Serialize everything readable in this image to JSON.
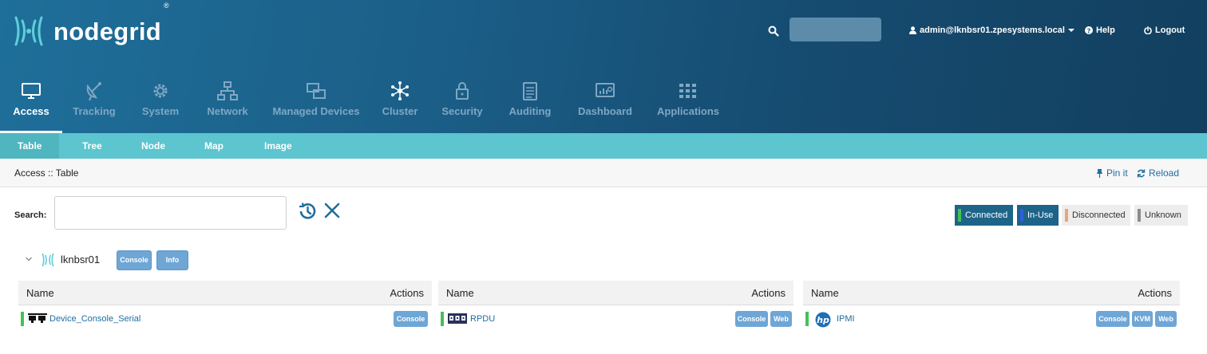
{
  "header": {
    "brand": "nodegrid",
    "brand_reg": "®",
    "search_placeholder": "",
    "user": "admin@lknbsr01.zpesystems.local",
    "help": "Help",
    "logout": "Logout"
  },
  "nav": [
    {
      "label": "Access",
      "icon": "monitor-icon"
    },
    {
      "label": "Tracking",
      "icon": "satellite-dish-icon"
    },
    {
      "label": "System",
      "icon": "gear-icon"
    },
    {
      "label": "Network",
      "icon": "network-icon"
    },
    {
      "label": "Managed Devices",
      "icon": "devices-icon"
    },
    {
      "label": "Cluster",
      "icon": "cluster-icon"
    },
    {
      "label": "Security",
      "icon": "lock-icon"
    },
    {
      "label": "Auditing",
      "icon": "notepad-icon"
    },
    {
      "label": "Dashboard",
      "icon": "dashboard-icon"
    },
    {
      "label": "Applications",
      "icon": "grid-icon"
    }
  ],
  "subnav": [
    "Table",
    "Tree",
    "Node",
    "Map",
    "Image"
  ],
  "breadcrumb": "Access :: Table",
  "actions": {
    "pin": "Pin it",
    "reload": "Reload"
  },
  "search": {
    "label": "Search:",
    "value": ""
  },
  "legend": [
    {
      "label": "Connected",
      "color": "#43c159"
    },
    {
      "label": "In-Use",
      "color": "#2f5fe0"
    },
    {
      "label": "Disconnected",
      "color": "#e8a678"
    },
    {
      "label": "Unknown",
      "color": "#8c8c8c"
    }
  ],
  "node": {
    "name": "lknbsr01",
    "buttons": [
      "Console",
      "Info"
    ]
  },
  "tables": [
    {
      "col_name": "Name",
      "col_actions": "Actions",
      "device": "Device_Console_Serial",
      "icon": "serial-port-icon",
      "buttons": [
        "Console"
      ]
    },
    {
      "col_name": "Name",
      "col_actions": "Actions",
      "device": "RPDU",
      "icon": "pdu-icon",
      "buttons": [
        "Console",
        "Web"
      ]
    },
    {
      "col_name": "Name",
      "col_actions": "Actions",
      "device": "IPMI",
      "icon": "hp-logo-icon",
      "buttons": [
        "Console",
        "KVM",
        "Web"
      ]
    }
  ]
}
